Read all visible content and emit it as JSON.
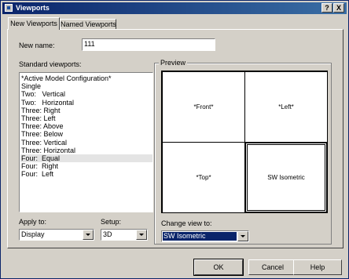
{
  "window": {
    "title": "Viewports",
    "help_button": "?",
    "close_button": "X"
  },
  "tabs": [
    {
      "label": "New Viewports",
      "active": true
    },
    {
      "label": "Named Viewports",
      "active": false
    }
  ],
  "new_name": {
    "label": "New name:",
    "value": "111"
  },
  "standard_viewports": {
    "label": "Standard viewports:",
    "items": [
      "*Active Model Configuration*",
      "Single",
      "Two:   Vertical",
      "Two:   Horizontal",
      "Three: Right",
      "Three: Left",
      "Three: Above",
      "Three: Below",
      "Three: Vertical",
      "Three: Horizontal",
      "Four:  Equal",
      "Four:  Right",
      "Four:  Left"
    ],
    "selected_item": "Four:  Equal"
  },
  "apply_to": {
    "label": "Apply to:",
    "value": "Display"
  },
  "setup": {
    "label": "Setup:",
    "value": "3D"
  },
  "preview": {
    "label": "Preview",
    "viewports": [
      "*Front*",
      "*Left*",
      "*Top*",
      "SW Isometric"
    ],
    "active_viewport": "SW Isometric"
  },
  "change_view_to": {
    "label": "Change view to:",
    "value": "SW Isometric"
  },
  "buttons": {
    "ok": "OK",
    "cancel": "Cancel",
    "help": "Help"
  },
  "colors": {
    "title_bar": "#0a246a",
    "dialog_face": "#d4d0c8",
    "selection": "#0a246a"
  }
}
